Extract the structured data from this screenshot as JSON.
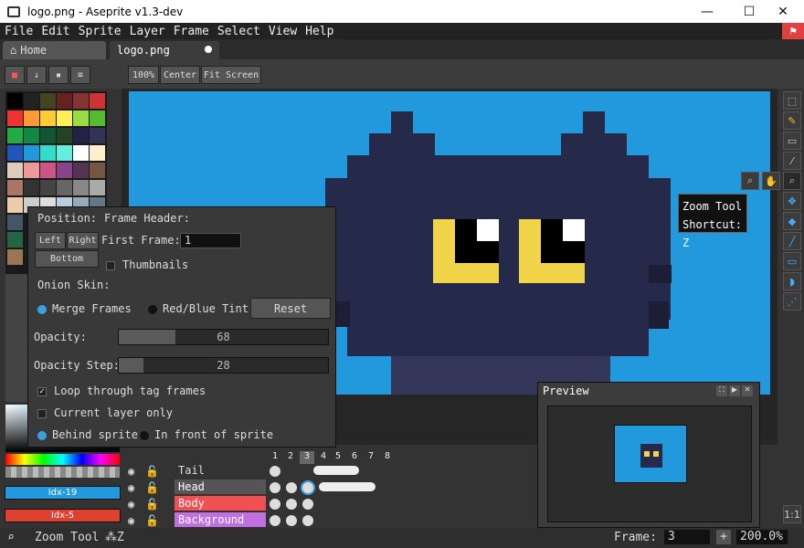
{
  "window": {
    "title": "logo.png - Aseprite v1.3-dev",
    "minimize": "—",
    "maximize": "☐",
    "close": "✕"
  },
  "menu": [
    "File",
    "Edit",
    "Sprite",
    "Layer",
    "Frame",
    "Select",
    "View",
    "Help"
  ],
  "tabs": {
    "home": "Home",
    "file": "logo.png"
  },
  "toolbar": {
    "zoom100": "100%",
    "center": "Center",
    "fit": "Fit Screen"
  },
  "tooltip": {
    "line1": "Zoom Tool",
    "line2": "Shortcut: Z"
  },
  "frame_panel": {
    "position_label": "Position:",
    "left": "Left",
    "right": "Right",
    "bottom": "Bottom",
    "frame_header_label": "Frame Header:",
    "first_frame_label": "First Frame:",
    "first_frame_value": "1",
    "thumbnails_label": "Thumbnails",
    "onion_skin_label": "Onion Skin:",
    "merge_frames": "Merge Frames",
    "red_blue_tint": "Red/Blue Tint",
    "reset": "Reset",
    "opacity_label": "Opacity:",
    "opacity_value": "68",
    "opacity_step_label": "Opacity Step:",
    "opacity_step_value": "28",
    "loop_label": "Loop through tag frames",
    "current_layer_label": "Current layer only",
    "behind_label": "Behind sprite",
    "front_label": "In front of sprite"
  },
  "timeline": {
    "frames": [
      "1",
      "2",
      "3",
      "4",
      "5",
      "6",
      "7",
      "8"
    ],
    "layers": [
      {
        "name": "Tail",
        "color": "#333333"
      },
      {
        "name": "Head",
        "color": "#555555"
      },
      {
        "name": "Body",
        "color": "#f05050"
      },
      {
        "name": "Background",
        "color": "#c070e0"
      }
    ]
  },
  "preview": {
    "title": "Preview"
  },
  "colors": {
    "fg_index": "Idx-19",
    "bg_index": "Idx-5",
    "fg": "#2299dd",
    "bg": "#e04030"
  },
  "status": {
    "tool": "Zoom Tool",
    "shortcut": "Z",
    "frame_label": "Frame:",
    "frame_value": "3",
    "zoom": "200.0%",
    "plus": "+"
  }
}
